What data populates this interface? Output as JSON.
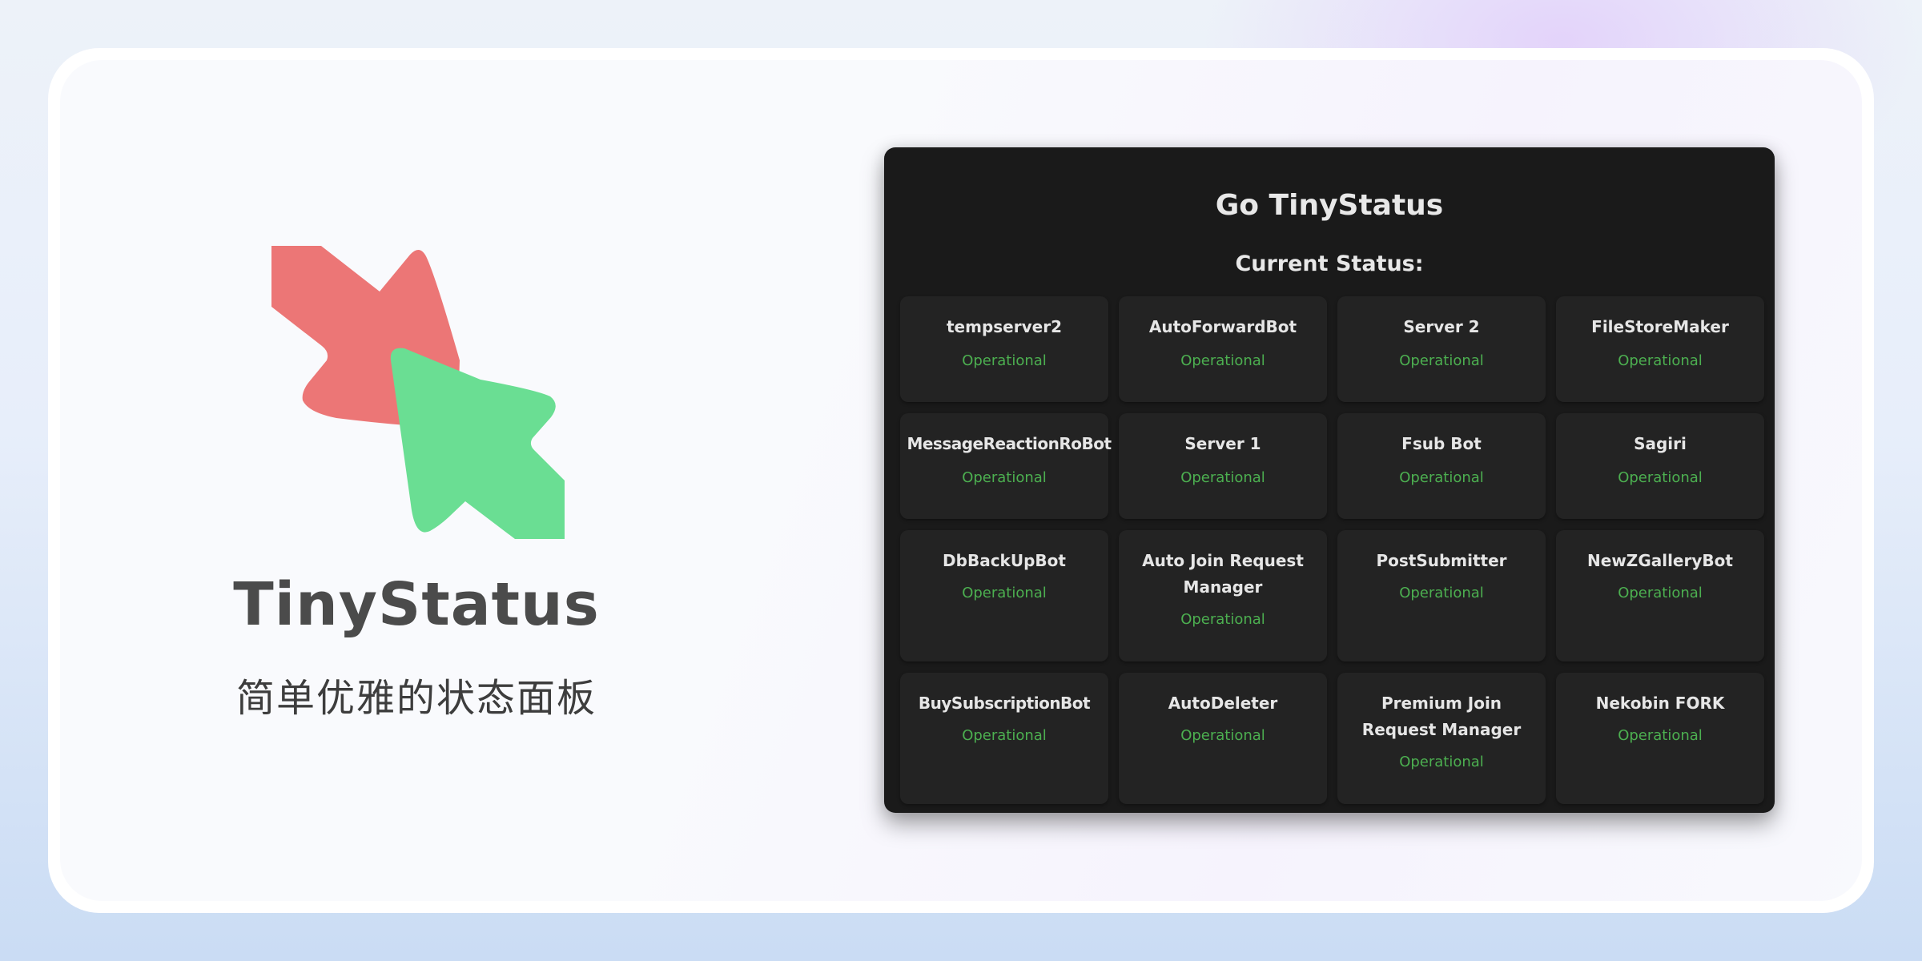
{
  "brand": {
    "name": "TinyStatus",
    "tagline": "简单优雅的状态面板",
    "logo": {
      "icon": "two-opposing-cursor-arrows-logo",
      "colors": {
        "red_arrow": "#ec7676",
        "green_arrow": "#6ade93"
      }
    }
  },
  "panel": {
    "title": "Go TinyStatus",
    "subtitle": "Current Status:",
    "colors": {
      "background": "#1a1a1a",
      "card": "#232323",
      "text": "#e6e6e6",
      "status_operational": "#4caf50"
    }
  },
  "services": [
    {
      "name": "tempserver2",
      "status": "Operational"
    },
    {
      "name": "AutoForwardBot",
      "status": "Operational"
    },
    {
      "name": "Server 2",
      "status": "Operational"
    },
    {
      "name": "FileStoreMaker",
      "status": "Operational"
    },
    {
      "name": "MessageReactionRoBot",
      "status": "Operational"
    },
    {
      "name": "Server 1",
      "status": "Operational"
    },
    {
      "name": "Fsub Bot",
      "status": "Operational"
    },
    {
      "name": "Sagiri",
      "status": "Operational"
    },
    {
      "name": "DbBackUpBot",
      "status": "Operational"
    },
    {
      "name": "Auto Join Request Manager",
      "status": "Operational"
    },
    {
      "name": "PostSubmitter",
      "status": "Operational"
    },
    {
      "name": "NewZGalleryBot",
      "status": "Operational"
    },
    {
      "name": "BuySubscriptionBot",
      "status": "Operational"
    },
    {
      "name": "AutoDeleter",
      "status": "Operational"
    },
    {
      "name": "Premium Join Request Manager",
      "status": "Operational"
    },
    {
      "name": "Nekobin FORK",
      "status": "Operational"
    }
  ]
}
